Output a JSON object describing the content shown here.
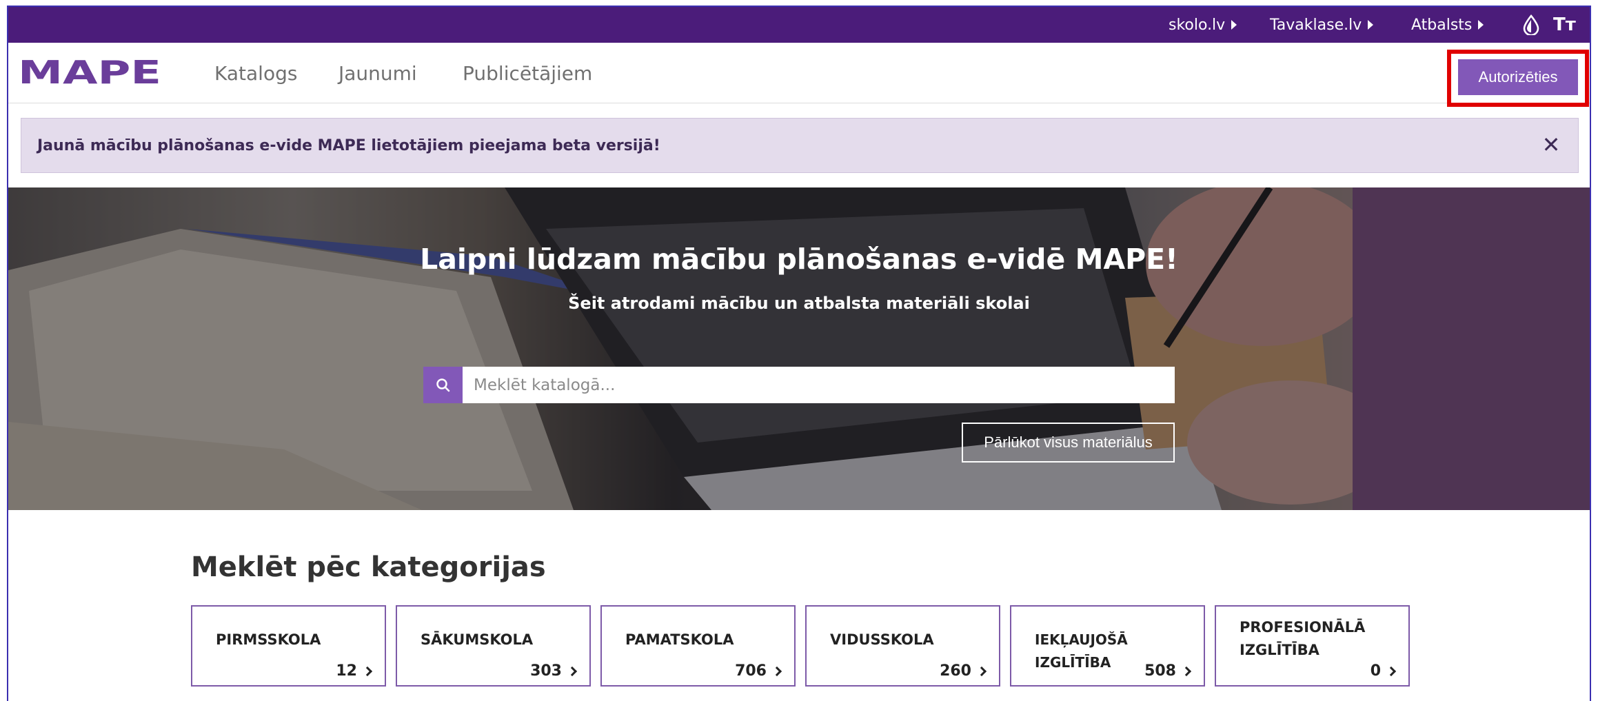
{
  "topbar": {
    "links": [
      {
        "label": "skolo.lv"
      },
      {
        "label": "Tavaklase.lv"
      },
      {
        "label": "Atbalsts"
      }
    ],
    "contrast_icon": "contrast-drop-icon",
    "text_size_label": "Tт",
    "text_size_icon": "text-size-icon",
    "bar_color": "#4b1c7a"
  },
  "header": {
    "logo_text": "MAPE",
    "logo_color": "#6a3d9a",
    "nav": [
      {
        "label": "Katalogs"
      },
      {
        "label": "Jaunumi"
      },
      {
        "label": "Publicētājiem"
      }
    ],
    "login_label": "Autorizēties",
    "accent_color": "#8258b8",
    "highlight_color": "#e00000"
  },
  "notice": {
    "text": "Jaunā mācību plānošanas e-vide MAPE lietotājiem pieejama beta versijā!",
    "close_label": "✕",
    "close_icon": "close-icon",
    "background": "#e4dcec"
  },
  "hero": {
    "title": "Laipni lūdzam mācību plānošanas e-vidē MAPE!",
    "subtitle": "Šeit atrodami mācību un atbalsta materiāli skolai",
    "search_placeholder": "Meklēt katalogā...",
    "search_icon": "search-icon",
    "browse_label": "Pārlūkot visus materiālus"
  },
  "categories": {
    "title": "Meklēt pēc kategorijas",
    "items": [
      {
        "name": "PIRMSSKOLA",
        "count": "12"
      },
      {
        "name": "SĀKUMSKOLA",
        "count": "303"
      },
      {
        "name": "PAMATSKOLA",
        "count": "706"
      },
      {
        "name": "VIDUSSKOLA",
        "count": "260"
      },
      {
        "name": "IEKĻAUJOŠĀ IZGLĪTĪBA",
        "count": "508"
      },
      {
        "name": "PROFESIONĀLĀ IZGLĪTĪBA",
        "count": "0"
      }
    ]
  }
}
